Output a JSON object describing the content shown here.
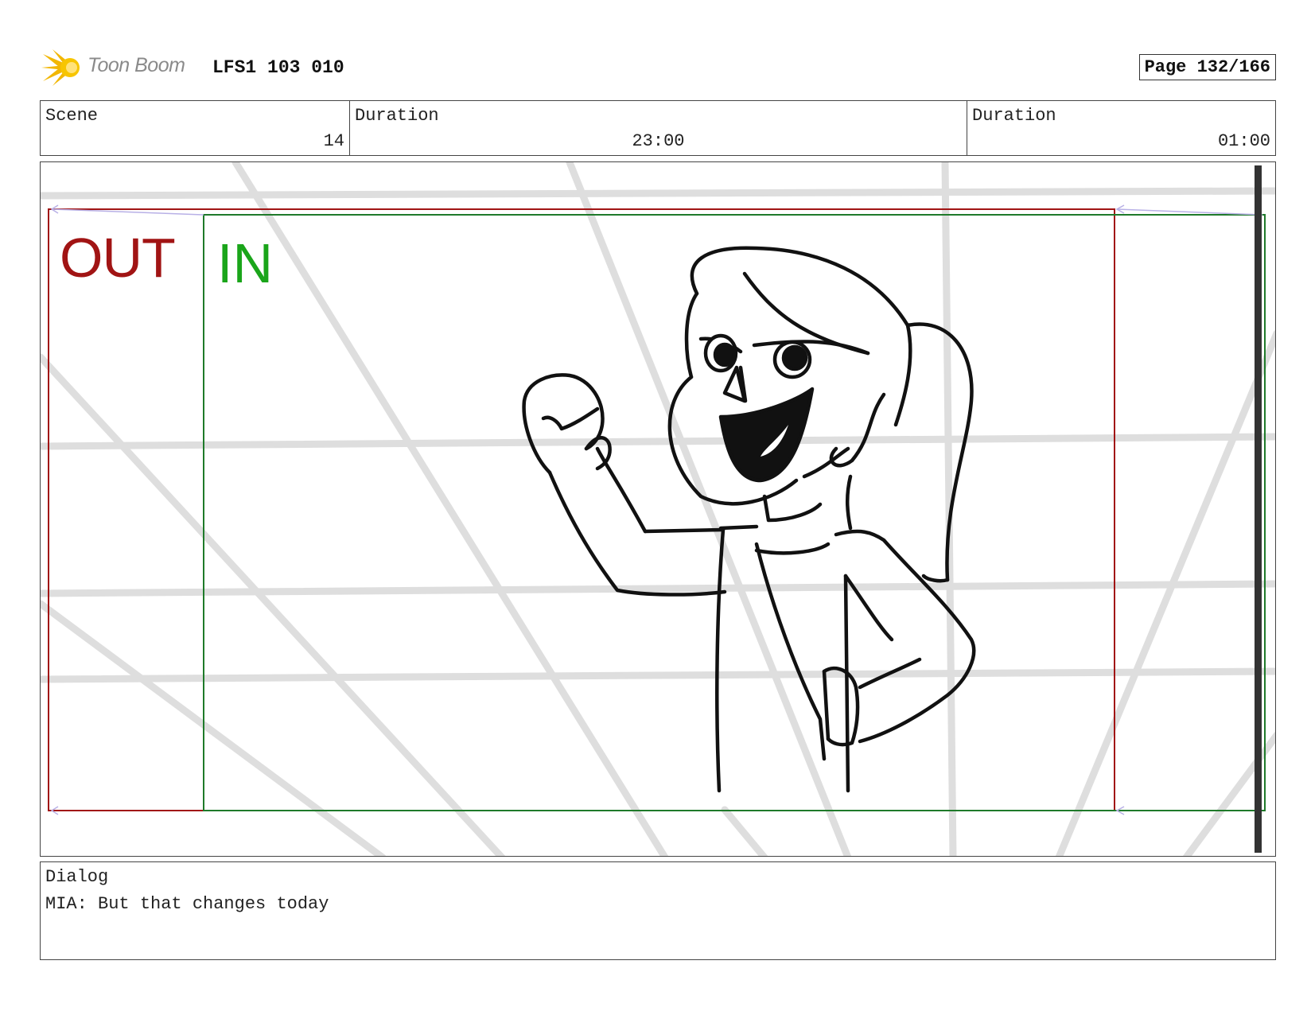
{
  "header": {
    "brand": "Toon Boom",
    "production_code": "LFS1 103 010",
    "page_label": "Page 132/166"
  },
  "info": {
    "scene_label": "Scene",
    "scene_value": "14",
    "duration_label": "Duration",
    "duration_value": "23:00",
    "panel_duration_label": "Duration",
    "panel_duration_value": "01:00"
  },
  "panel": {
    "out_label": "OUT",
    "in_label": "IN",
    "colors": {
      "out": "#a11414",
      "in": "#1f7a2a",
      "guides": "#dcdcdc",
      "ink": "#111111"
    }
  },
  "dialog": {
    "label": "Dialog",
    "text": "MIA: But that changes today"
  },
  "icons": {
    "logo": "toon-boom-starburst-icon"
  }
}
